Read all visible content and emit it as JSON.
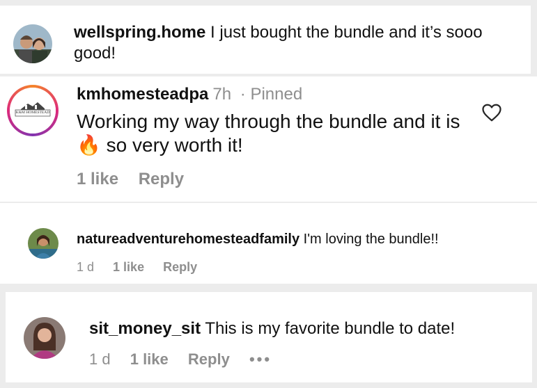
{
  "comments": [
    {
      "username": "wellspring.home",
      "text": "I just bought the bundle and it’s sooo good!"
    },
    {
      "username": "kmhomesteadpa",
      "time": "7h",
      "pinned": "· Pinned",
      "avatar_text": "K&M HOMESTEAD",
      "text_before": "Working my way through the bundle and it is",
      "emoji": "🔥",
      "text_after": "so very worth it!",
      "likes": "1 like",
      "reply": "Reply"
    },
    {
      "username": "natureadventurehomesteadfamily",
      "text": "I'm loving the bundle!!",
      "time": "1 d",
      "likes": "1 like",
      "reply": "Reply"
    },
    {
      "username": "sit_money_sit",
      "text": "This is my favorite bundle to date!",
      "time": "1 d",
      "likes": "1 like",
      "reply": "Reply",
      "more": "•••"
    }
  ],
  "colors": {
    "secondary_text": "#8e8e8e",
    "background": "#ececec",
    "story_ring": [
      "#f58529",
      "#dd2a7b",
      "#8134af"
    ]
  }
}
